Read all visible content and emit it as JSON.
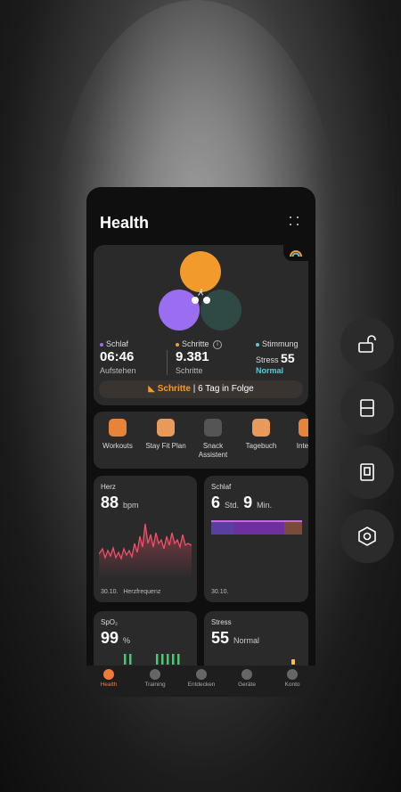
{
  "app": {
    "title": "Health"
  },
  "summary": {
    "sleep_label": "Schlaf",
    "sleep_value": "06:46",
    "sleep_sub": "Aufstehen",
    "steps_label": "Schritte",
    "steps_value": "9.381",
    "steps_sub": "Schritte",
    "mood_label": "Stimmung",
    "stress_label": "Stress",
    "stress_value": "55",
    "mood_value": "Normal",
    "streak_highlight": "Schritte",
    "streak_text": "| 6 Tag in Folge"
  },
  "tools": [
    {
      "label": "Workouts"
    },
    {
      "label": "Stay Fit Plan"
    },
    {
      "label": "Snack Assistent"
    },
    {
      "label": "Tagebuch"
    },
    {
      "label": "Interva"
    }
  ],
  "tiles": {
    "heart": {
      "title": "Herz",
      "value": "88",
      "unit": "bpm",
      "footer_date": "30.10.",
      "footer_label": "Herzfrequenz"
    },
    "sleep": {
      "title": "Schlaf",
      "hours": "6",
      "hours_unit": "Std.",
      "minutes": "9",
      "minutes_unit": "Min.",
      "footer_date": "30.10."
    },
    "spo2": {
      "title": "SpO₂",
      "value": "99",
      "unit": "%"
    },
    "stress": {
      "title": "Stress",
      "value": "55",
      "unit": "Normal"
    }
  },
  "nav": [
    {
      "label": "Health",
      "active": true
    },
    {
      "label": "Training"
    },
    {
      "label": "Entdecken"
    },
    {
      "label": "Geräte"
    },
    {
      "label": "Konto"
    }
  ],
  "colors": {
    "accent": "#f07a3a",
    "orange_circle": "#f39a2c",
    "purple_circle": "#9b6ef1",
    "teal_circle": "#2f4a45",
    "heart_line": "#f0506a",
    "mood_text": "#5cc8d6"
  },
  "icons": {
    "side_buttons": [
      "unlock-icon",
      "split-screen-icon",
      "popup-window-icon",
      "settings-hexagon-icon"
    ]
  }
}
